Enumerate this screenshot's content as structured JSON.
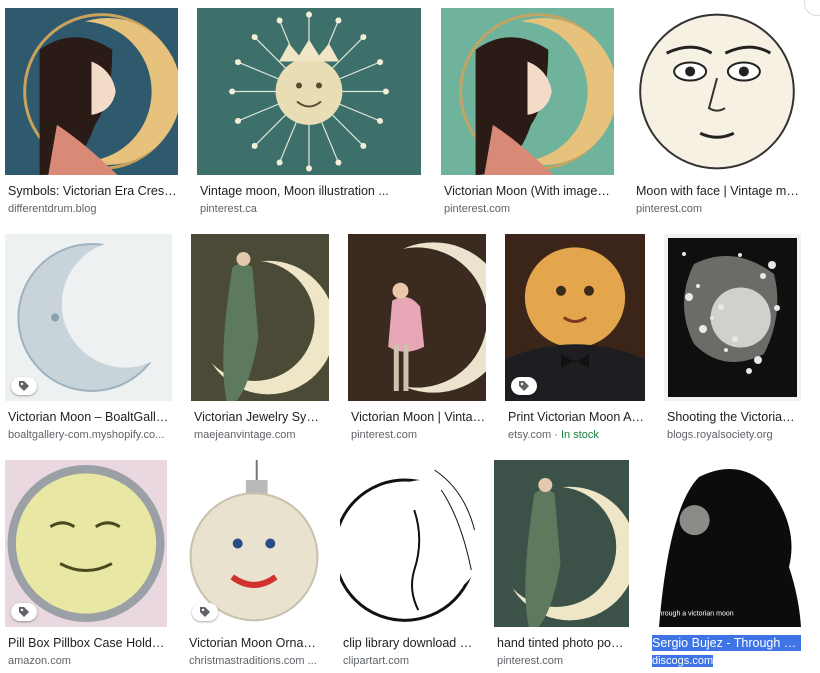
{
  "results": [
    {
      "title": "Symbols: Victorian Era Cresce...",
      "source": "differentdrum.blog",
      "icon": "victorian-woman-kissing-crescent-moon"
    },
    {
      "title": "Vintage moon, Moon illustration ...",
      "source": "pinterest.ca",
      "icon": "sun-face-with-crown"
    },
    {
      "title": "Victorian Moon (With images) ...",
      "source": "pinterest.com",
      "icon": "victorian-woman-kissing-crescent-moon"
    },
    {
      "title": "Moon with face | Vintage mo...",
      "source": "pinterest.com",
      "icon": "full-moon-face-engraving"
    },
    {
      "title": "Victorian Moon – BoaltGaller...",
      "source": "boaltgallery-com.myshopify.co...",
      "icon": "glass-crescent-moon",
      "tagged": true
    },
    {
      "title": "Victorian Jewelry Symb...",
      "source": "maejeanvintage.com",
      "icon": "woman-with-lyre-on-crescent"
    },
    {
      "title": "Victorian Moon | Vintag...",
      "source": "pinterest.com",
      "icon": "girl-sitting-on-crescent"
    },
    {
      "title": "Print Victorian Moon Art...",
      "source": "etsy.com",
      "extra": "In stock",
      "icon": "moon-head-gentleman-bowtie",
      "tagged": true
    },
    {
      "title": "Shooting the Victorian ...",
      "source": "blogs.royalsociety.org",
      "icon": "moon-photograph-dark-frame"
    },
    {
      "title": "Pill Box Pillbox Case Holder ...",
      "source": "amazon.com",
      "icon": "smiling-moon-pillbox",
      "tagged": true
    },
    {
      "title": "Victorian Moon Ornam...",
      "source": "christmastraditions.com ...",
      "icon": "moon-face-glass-ornament",
      "tagged": true
    },
    {
      "title": "clip library download m...",
      "source": "clipartart.com",
      "icon": "crescent-moon-face-line-art"
    },
    {
      "title": "hand tinted photo post...",
      "source": "pinterest.com",
      "icon": "woman-on-crescent-green-tint"
    },
    {
      "title": "Sergio Bujez - Through a V...",
      "source": "discogs.com",
      "icon": "moon-through-silhouette",
      "highlighted": true,
      "caption": "through a victorian moon"
    }
  ],
  "colors": {
    "title": "#202124",
    "source": "#5f6368",
    "in_stock": "#188038",
    "selection": "#3f74e6"
  }
}
